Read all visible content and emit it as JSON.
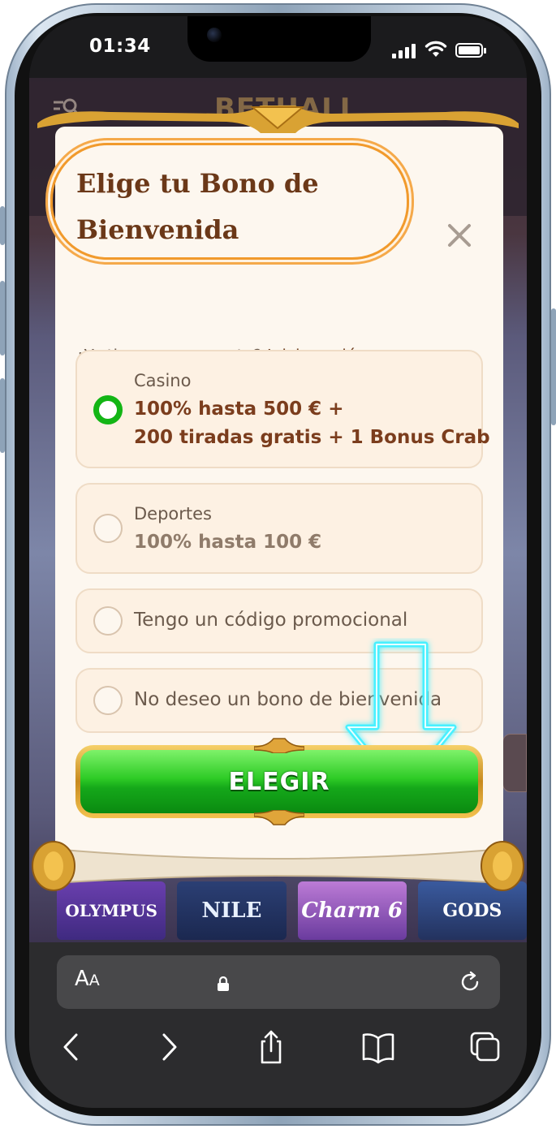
{
  "status_bar": {
    "time": "01:34",
    "icons": [
      "signal-icon",
      "wifi-icon",
      "battery-icon"
    ]
  },
  "site": {
    "logo_text": "BETHALL",
    "games": [
      "OLYMPUS",
      "NILE",
      "Charm 6",
      "GODS"
    ]
  },
  "modal": {
    "title": "Elige tu Bono de Bienvenida",
    "close_icon": "close-icon",
    "account_prompt": "¿Ya tienes una cuenta?",
    "login_link": "Inicia sesión",
    "options": [
      {
        "label": "Casino",
        "value_line1": "100% hasta 500 € +",
        "value_line2": "200 tiradas gratis + 1 Bonus Crab",
        "selected": true
      },
      {
        "label": "Deportes",
        "value_line1": "100% hasta 100 €",
        "selected": false
      },
      {
        "label": "Tengo un código promocional",
        "selected": false
      },
      {
        "label": "No deseo un bono de bienvenida",
        "selected": false
      }
    ],
    "cta_label": "ELEGIR"
  },
  "colors": {
    "accent_orange": "#f19a2c",
    "title_brown": "#6b3818",
    "radio_selected_green": "#13b515",
    "cta_green": "#2ecb26",
    "cta_gold": "#d9a233",
    "neon_arrow": "#48f0ff"
  },
  "browser": {
    "text_size_label_big": "A",
    "text_size_label_small": "A",
    "icons": [
      "lock-icon",
      "reload-icon",
      "back-icon",
      "forward-icon",
      "share-icon",
      "bookmarks-icon",
      "tabs-icon"
    ]
  }
}
